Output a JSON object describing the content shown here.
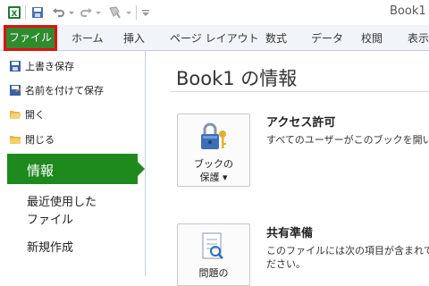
{
  "window": {
    "title": "Book1"
  },
  "ribbon": {
    "file_tab": "ファイル",
    "tabs": [
      "ホーム",
      "挿入",
      "ページ レイアウト",
      "数式",
      "データ",
      "校閲",
      "表示"
    ]
  },
  "backstage": {
    "menu": [
      "上書き保存",
      "名前を付けて保存",
      "開く",
      "閉じる"
    ],
    "active": "情報",
    "recent": "最近使用した\nファイル",
    "new": "新規作成"
  },
  "info": {
    "title": "Book1 の情報",
    "protect_button": "ブックの\n保護 ▾",
    "permissions_title": "アクセス許可",
    "permissions_text": "すべてのユーザーがこのブックを開い",
    "prepare_title": "共有準備",
    "prepare_text_1": "このファイルには次の項目が含まれて",
    "prepare_text_2": "ださい。",
    "check_button": "問題の"
  },
  "colors": {
    "file_tab": "#2e8b2e",
    "highlight_border": "#e01010",
    "active_item": "#1e8a1e"
  }
}
